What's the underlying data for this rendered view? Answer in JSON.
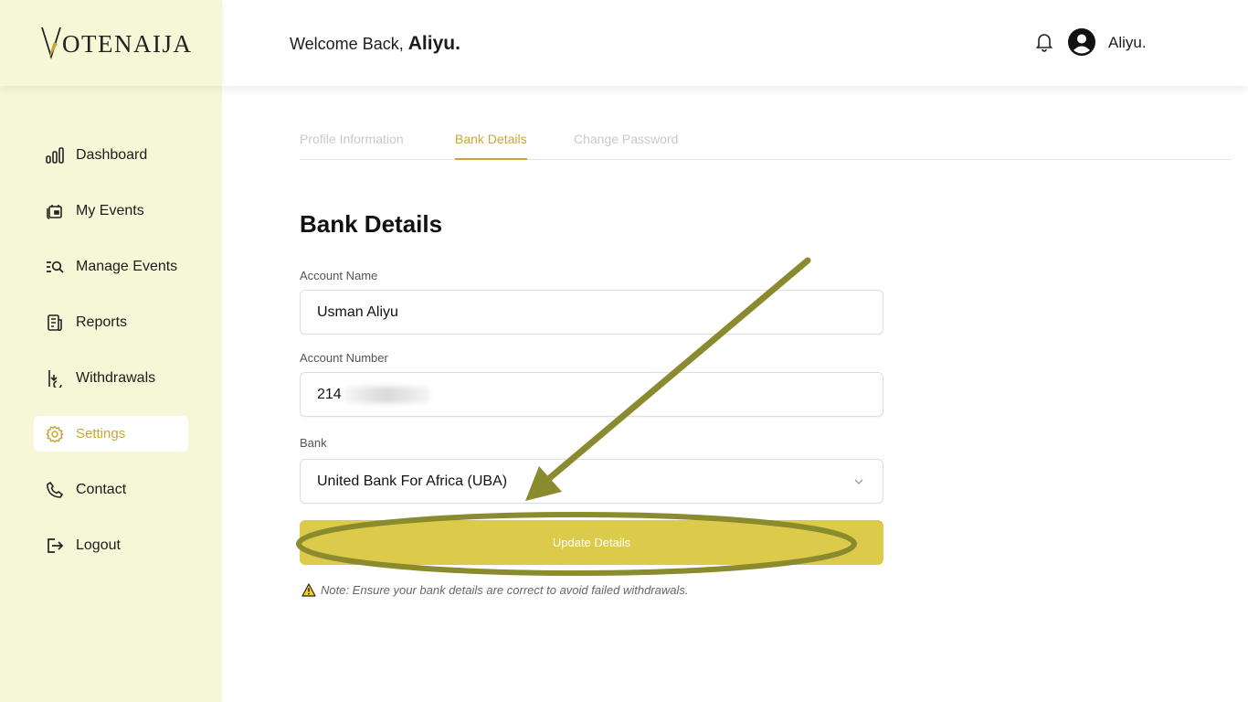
{
  "brand": {
    "logo_text": "OTENAIJA",
    "logo_initial": "V"
  },
  "header": {
    "welcome_prefix": "Welcome Back,",
    "welcome_name": "Aliyu.",
    "username": "Aliyu."
  },
  "sidebar": {
    "items": [
      {
        "label": "Dashboard",
        "icon": "bar-chart-icon"
      },
      {
        "label": "My Events",
        "icon": "calendar-icon"
      },
      {
        "label": "Manage Events",
        "icon": "list-search-icon"
      },
      {
        "label": "Reports",
        "icon": "document-icon"
      },
      {
        "label": "Withdrawals",
        "icon": "withdraw-icon"
      },
      {
        "label": "Settings",
        "icon": "gear-icon",
        "active": true
      },
      {
        "label": "Contact",
        "icon": "phone-icon"
      },
      {
        "label": "Logout",
        "icon": "logout-icon"
      }
    ]
  },
  "tabs": [
    {
      "label": "Profile Information"
    },
    {
      "label": "Bank Details",
      "active": true
    },
    {
      "label": "Change Password"
    }
  ],
  "form": {
    "title": "Bank Details",
    "account_name_label": "Account Name",
    "account_name_value": "Usman Aliyu",
    "account_number_label": "Account Number",
    "account_number_value": "214",
    "bank_label": "Bank",
    "bank_value": "United Bank For Africa (UBA)",
    "submit_label": "Update Details",
    "note": "Note: Ensure your bank details are correct to avoid failed withdrawals."
  },
  "colors": {
    "accent": "#c9a637",
    "button": "#dccb4a",
    "sidebar_bg": "#f6f7d6",
    "annotation": "#8a8a2e"
  }
}
